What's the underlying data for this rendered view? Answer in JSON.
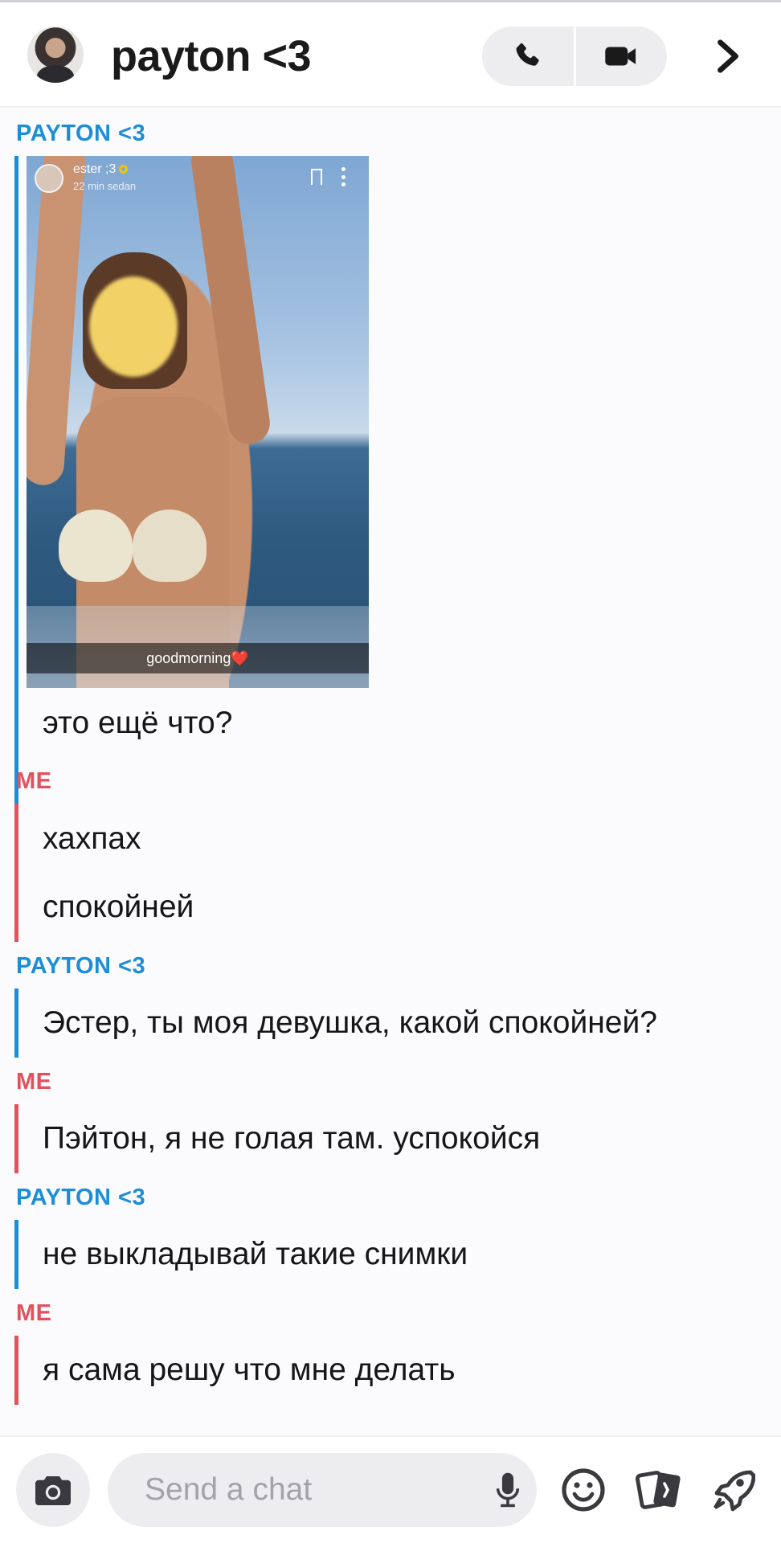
{
  "header": {
    "title": "payton <3",
    "icons": {
      "avatar": "profile-avatar",
      "call": "phone-icon",
      "video": "video-camera-icon",
      "more": "chevron-right-icon"
    }
  },
  "chat": {
    "senders": {
      "payton": "PAYTON <3",
      "me": "ME"
    },
    "snap": {
      "username": "ester ;3",
      "time": "22 min sedan",
      "caption": "goodmorning❤️"
    },
    "messages": [
      {
        "from": "payton",
        "text": "это ещё что?"
      },
      {
        "from": "me",
        "text": "хахпах"
      },
      {
        "from": "me",
        "text": "спокойней"
      },
      {
        "from": "payton",
        "text": "Эстер, ты моя девушка, какой спокойней?"
      },
      {
        "from": "me",
        "text": "Пэйтон, я не голая там. успокойся"
      },
      {
        "from": "payton",
        "text": "не выкладывай такие снимки"
      },
      {
        "from": "me",
        "text": "я сама решу что мне делать"
      }
    ]
  },
  "footer": {
    "placeholder": "Send a chat",
    "icons": {
      "camera": "camera-icon",
      "mic": "microphone-icon",
      "emoji": "emoji-icon",
      "stickers": "cards-icon",
      "games": "rocket-icon"
    }
  },
  "colors": {
    "payton": "#1d8ed6",
    "me": "#e0525e",
    "background": "#fbfbfd",
    "pill": "#ededf0"
  }
}
